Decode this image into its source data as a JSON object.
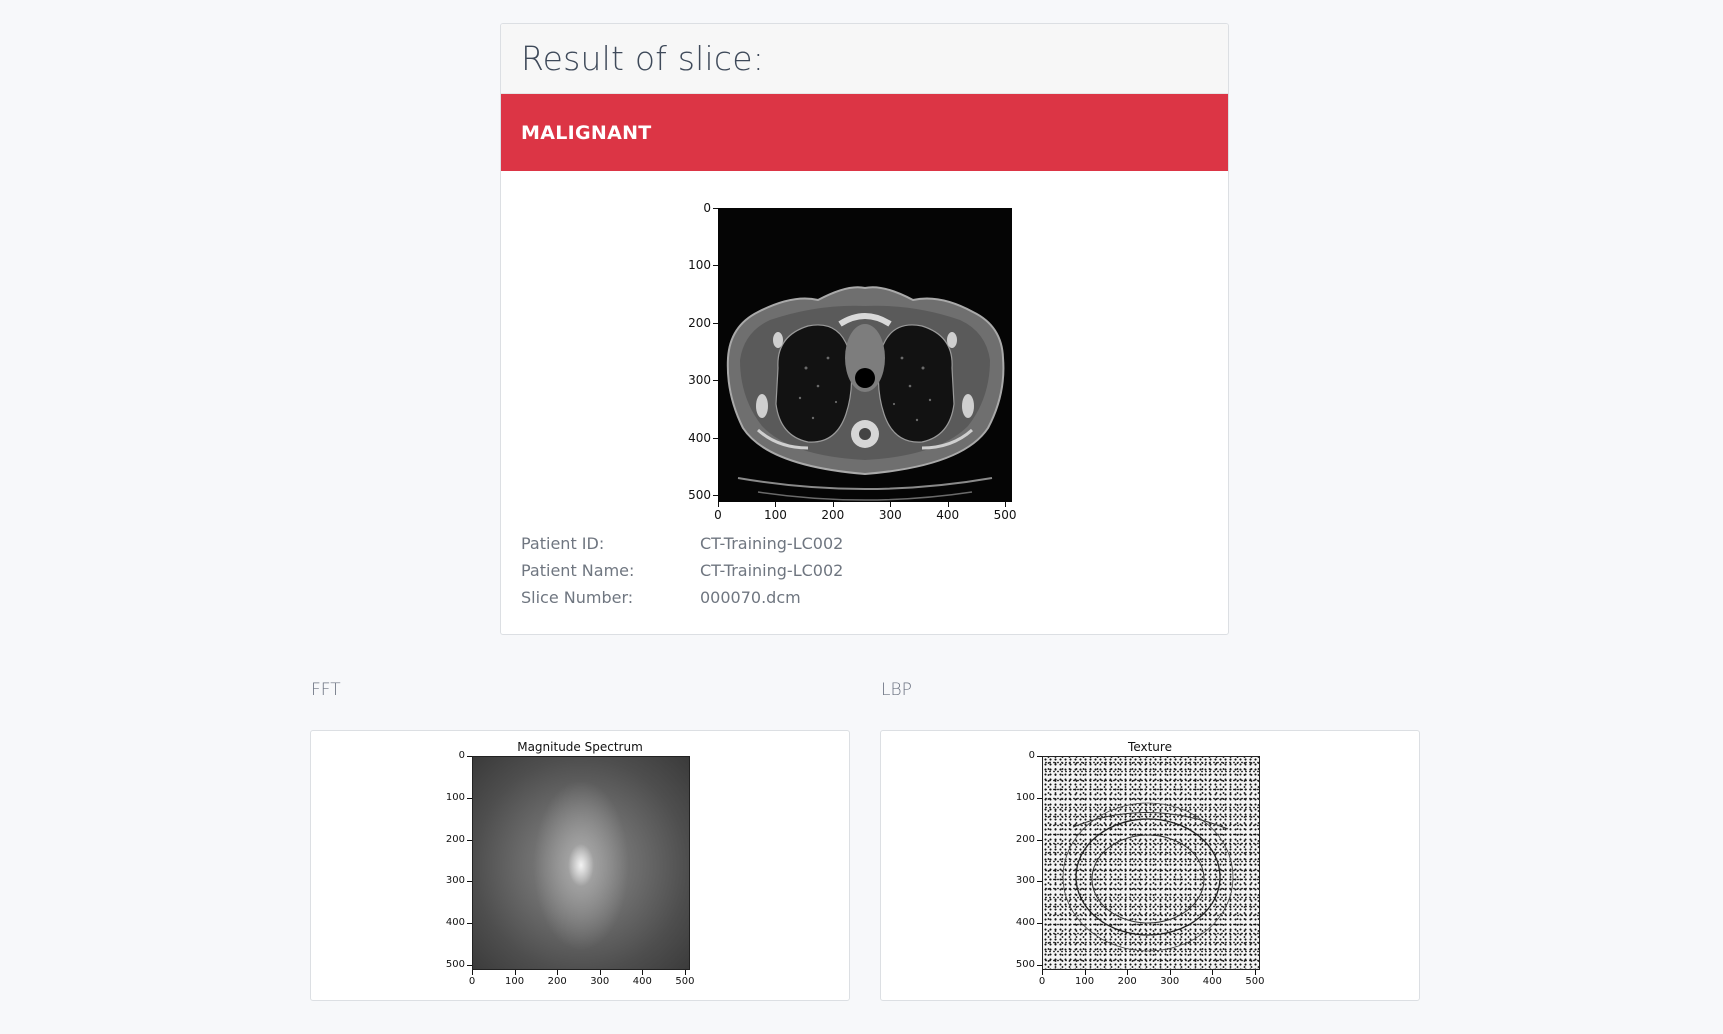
{
  "result": {
    "title": "Result of slice:",
    "verdict": "MALIGNANT",
    "verdict_color": "#dc3545"
  },
  "slice_plot": {
    "y_ticks": [
      "0",
      "100",
      "200",
      "300",
      "400",
      "500"
    ],
    "x_ticks": [
      "0",
      "100",
      "200",
      "300",
      "400",
      "500"
    ]
  },
  "patient": {
    "id_label": "Patient ID:",
    "id_value": "CT-Training-LC002",
    "name_label": "Patient Name:",
    "name_value": "CT-Training-LC002",
    "slice_label": "Slice Number:",
    "slice_value": "000070.dcm"
  },
  "fft": {
    "section_label": "FFT",
    "plot_title": "Magnitude Spectrum",
    "y_ticks": [
      "0",
      "100",
      "200",
      "300",
      "400",
      "500"
    ],
    "x_ticks": [
      "0",
      "100",
      "200",
      "300",
      "400",
      "500"
    ]
  },
  "lbp": {
    "section_label": "LBP",
    "plot_title": "Texture",
    "y_ticks": [
      "0",
      "100",
      "200",
      "300",
      "400",
      "500"
    ],
    "x_ticks": [
      "0",
      "100",
      "200",
      "300",
      "400",
      "500"
    ]
  }
}
